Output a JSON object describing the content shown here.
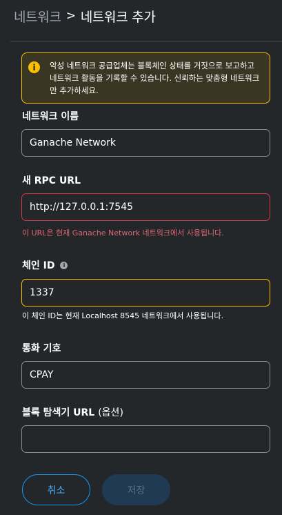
{
  "header": {
    "parent": "네트워크",
    "separator": ">",
    "current": "네트워크 추가"
  },
  "warning": {
    "icon": "info-icon",
    "text": "악성 네트워크 공급업체는 블록체인 상태를 거짓으로 보고하고 네트워크 활동을 기록할 수 있습니다. 신뢰하는 맞춤형 네트워크만 추가하세요."
  },
  "fields": {
    "network_name": {
      "label": "네트워크 이름",
      "value": "Ganache Network"
    },
    "rpc_url": {
      "label": "새 RPC URL",
      "value": "http://127.0.0.1:7545",
      "error": "이 URL은 현재 Ganache Network 네트워크에서 사용됩니다."
    },
    "chain_id": {
      "label": "체인 ID",
      "value": "1337",
      "note": "이 체인 ID는 현재 Localhost 8545 네트워크에서 사용됩니다."
    },
    "currency_symbol": {
      "label": "통화 기호",
      "value": "CPAY"
    },
    "block_explorer": {
      "label": "블록 탐색기 URL",
      "optional": "(옵션)",
      "value": ""
    }
  },
  "buttons": {
    "cancel": "취소",
    "save": "저장"
  },
  "colors": {
    "background": "#24272a",
    "warning_border": "#f8c000",
    "error": "#d73847",
    "primary": "#1098fc"
  }
}
